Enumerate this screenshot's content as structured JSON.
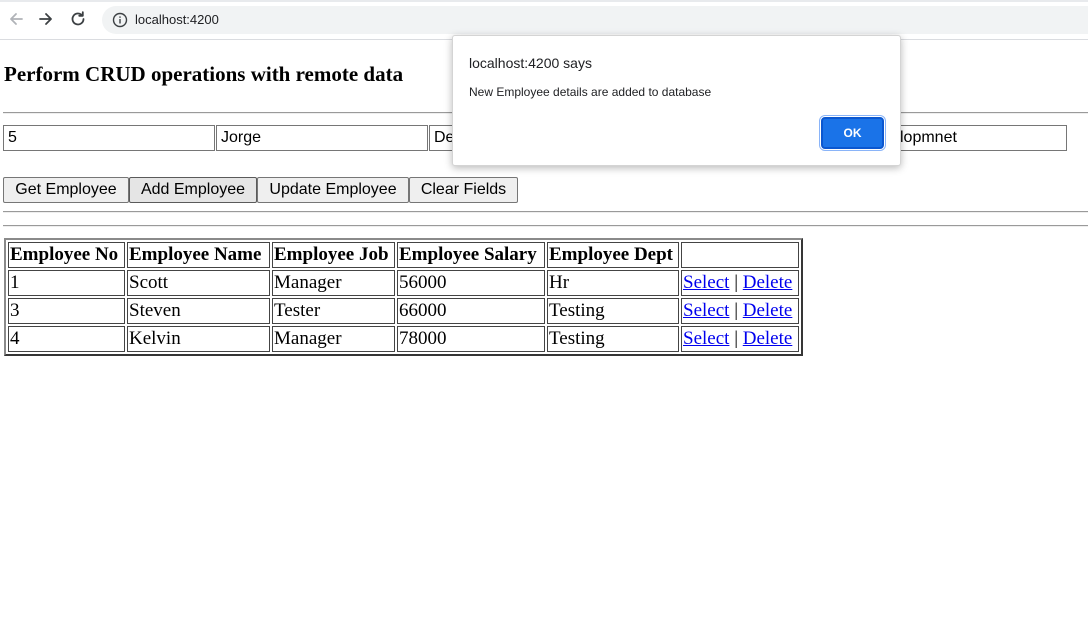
{
  "browser": {
    "url": "localhost:4200"
  },
  "page": {
    "title": "Perform CRUD operations with remote data"
  },
  "form": {
    "fields": [
      "5",
      "Jorge",
      "De",
      "lopmnet"
    ]
  },
  "buttons": {
    "get": "Get Employee",
    "add": "Add Employee",
    "update": "Update Employee",
    "clear": "Clear Fields"
  },
  "table": {
    "headers": [
      "Employee No",
      "Employee Name",
      "Employee Job",
      "Employee Salary",
      "Employee Dept",
      ""
    ],
    "rows": [
      {
        "no": "1",
        "name": "Scott",
        "job": "Manager",
        "salary": "56000",
        "dept": "Hr"
      },
      {
        "no": "3",
        "name": "Steven",
        "job": "Tester",
        "salary": "66000",
        "dept": "Testing"
      },
      {
        "no": "4",
        "name": "Kelvin",
        "job": "Manager",
        "salary": "78000",
        "dept": "Testing"
      }
    ],
    "actions": {
      "select": "Select",
      "delete": "Delete",
      "separator": "|"
    }
  },
  "dialog": {
    "title": "localhost:4200 says",
    "message": "New Employee details are added to database",
    "ok_label": "OK"
  },
  "colors": {
    "link": "#0000ee",
    "dialog_button": "#1a73e8",
    "omnibox_bg": "#f1f3f4"
  },
  "icons": [
    "back-arrow-icon",
    "forward-arrow-icon",
    "reload-icon",
    "info-icon"
  ]
}
